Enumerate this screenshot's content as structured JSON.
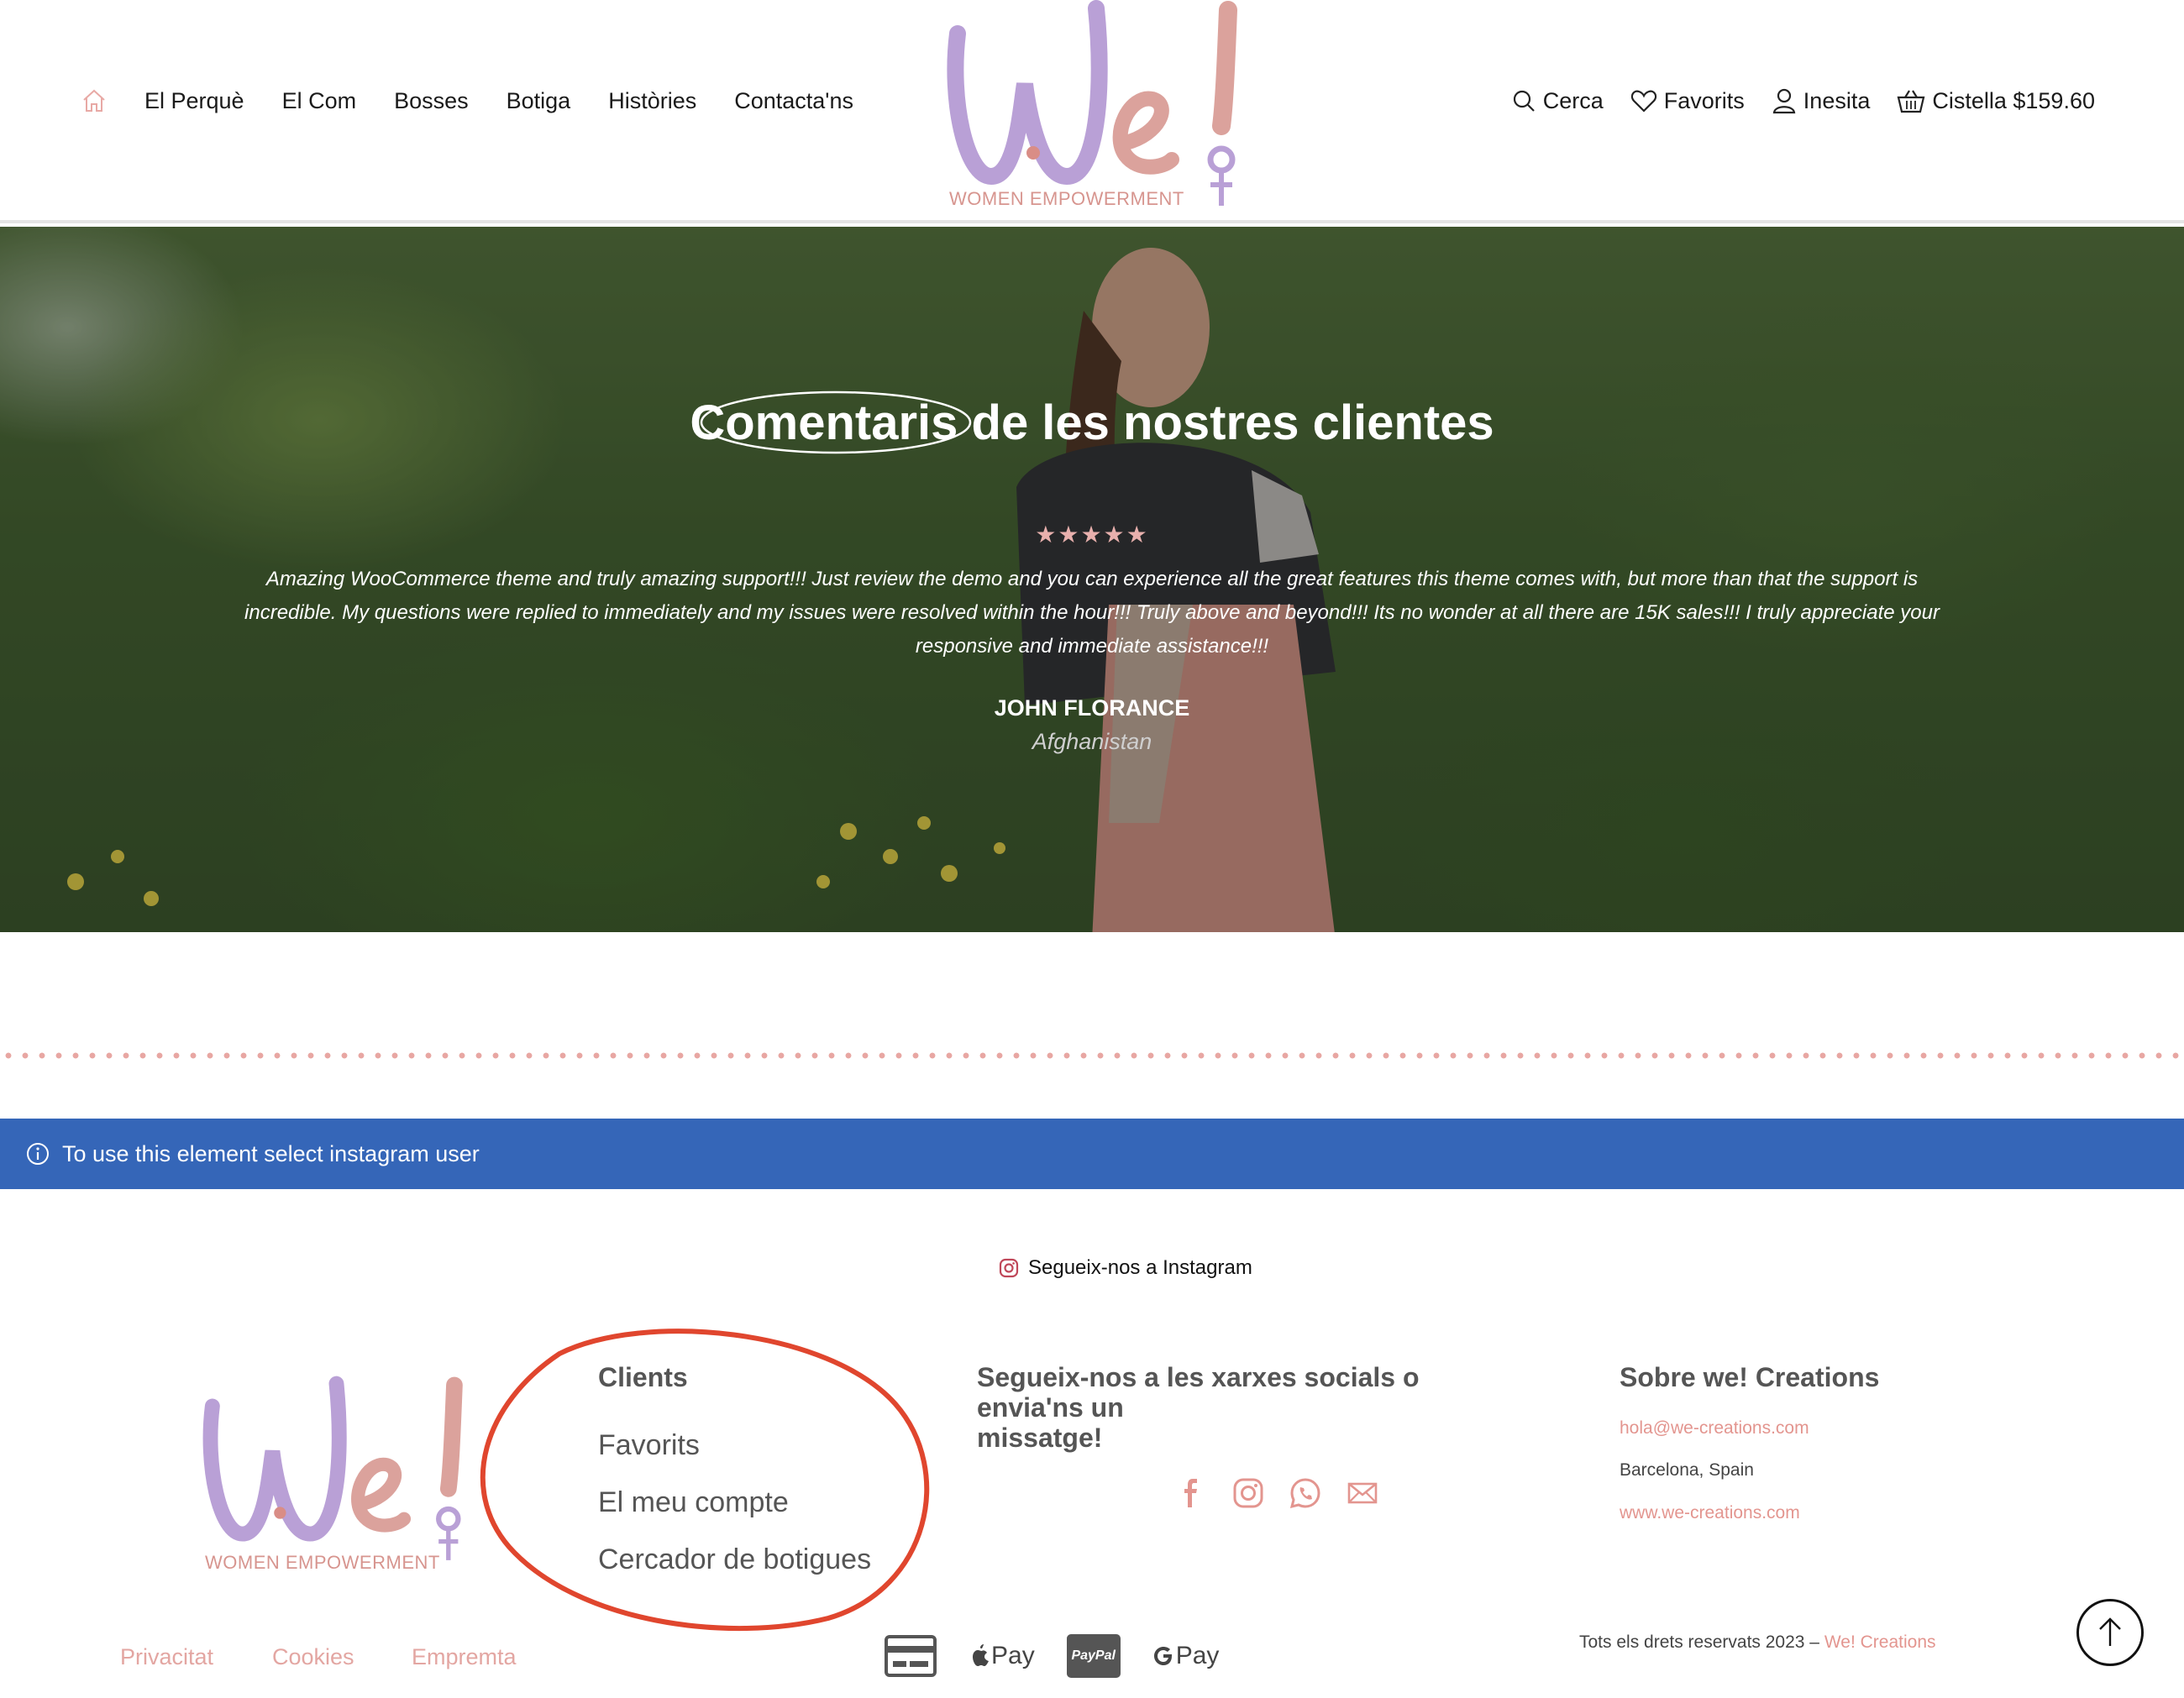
{
  "header": {
    "nav_left": [
      "El Perquè",
      "El Com",
      "Bosses",
      "Botiga",
      "Històries",
      "Contacta'ns"
    ],
    "search_label": "Cerca",
    "favorites_label": "Favorits",
    "account_label": "Inesita",
    "cart_label": "Cistella $159.60",
    "logo_tagline": "WOMEN EMPOWERMENT"
  },
  "hero": {
    "title": "Comentaris de les nostres clientes",
    "rating": 5,
    "stars": "★★★★★",
    "quote": "Amazing WooCommerce theme and truly amazing support!!! Just review the demo and you can experience all the great features this theme comes with, but more than that the support is incredible. My questions were replied to immediately and my issues were resolved within the hour!!! Truly above and beyond!!! Its no wonder at all there are 15K sales!!! I truly appreciate your responsive and immediate assistance!!!",
    "author": "JOHN FLORANCE",
    "country": "Afghanistan"
  },
  "notice": {
    "text": "To use this element select instagram user"
  },
  "instagram": {
    "follow_label": "Segueix-nos a Instagram"
  },
  "footer": {
    "logo_tagline": "WOMEN EMPOWERMENT",
    "clients": {
      "title": "Clients",
      "links": [
        "Favorits",
        "El meu compte",
        "Cercador de botigues"
      ]
    },
    "social": {
      "title_line1": "Segueix-nos a les xarxes socials o envia'ns un",
      "title_line2": "missatge!",
      "icons": [
        "facebook-icon",
        "instagram-icon",
        "whatsapp-icon",
        "email-icon"
      ]
    },
    "about": {
      "title": "Sobre we! Creations",
      "email": "hola@we-creations.com",
      "location": "Barcelona, Spain",
      "website": "www.we-creations.com"
    },
    "legal_links": [
      "Privacitat",
      "Cookies",
      "Empremta"
    ],
    "payments": [
      "card-icon",
      "apple-pay-icon",
      "paypal-icon",
      "google-pay-icon"
    ],
    "payment_labels": {
      "apple": "Pay",
      "paypal": "PayPal",
      "google": "Pay"
    },
    "copyright_prefix": "Tots els drets reservats 2023 –",
    "copyright_brand": "We! Creations"
  },
  "colors": {
    "accent_pink": "#e3958f",
    "logo_purple": "#b9a0d6",
    "logo_pink": "#dba29c",
    "notice_blue": "#3566b8",
    "annotation_red": "#e0462e"
  }
}
